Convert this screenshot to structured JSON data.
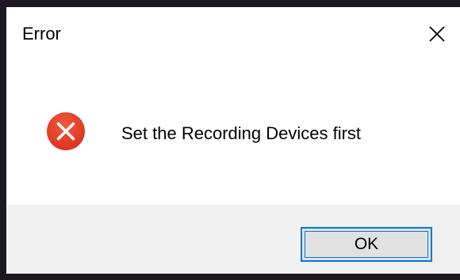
{
  "dialog": {
    "title": "Error",
    "message": "Set the Recording Devices first",
    "icon": "error-icon",
    "ok_label": "OK",
    "close_icon": "close-icon"
  },
  "colors": {
    "outer_background": "#1b1820",
    "dialog_background": "#ffffff",
    "footer_background": "#f0f0f0",
    "error_icon_fill": "#e81123",
    "button_focus_border": "#0078d7",
    "button_background": "#e1e1e1"
  }
}
